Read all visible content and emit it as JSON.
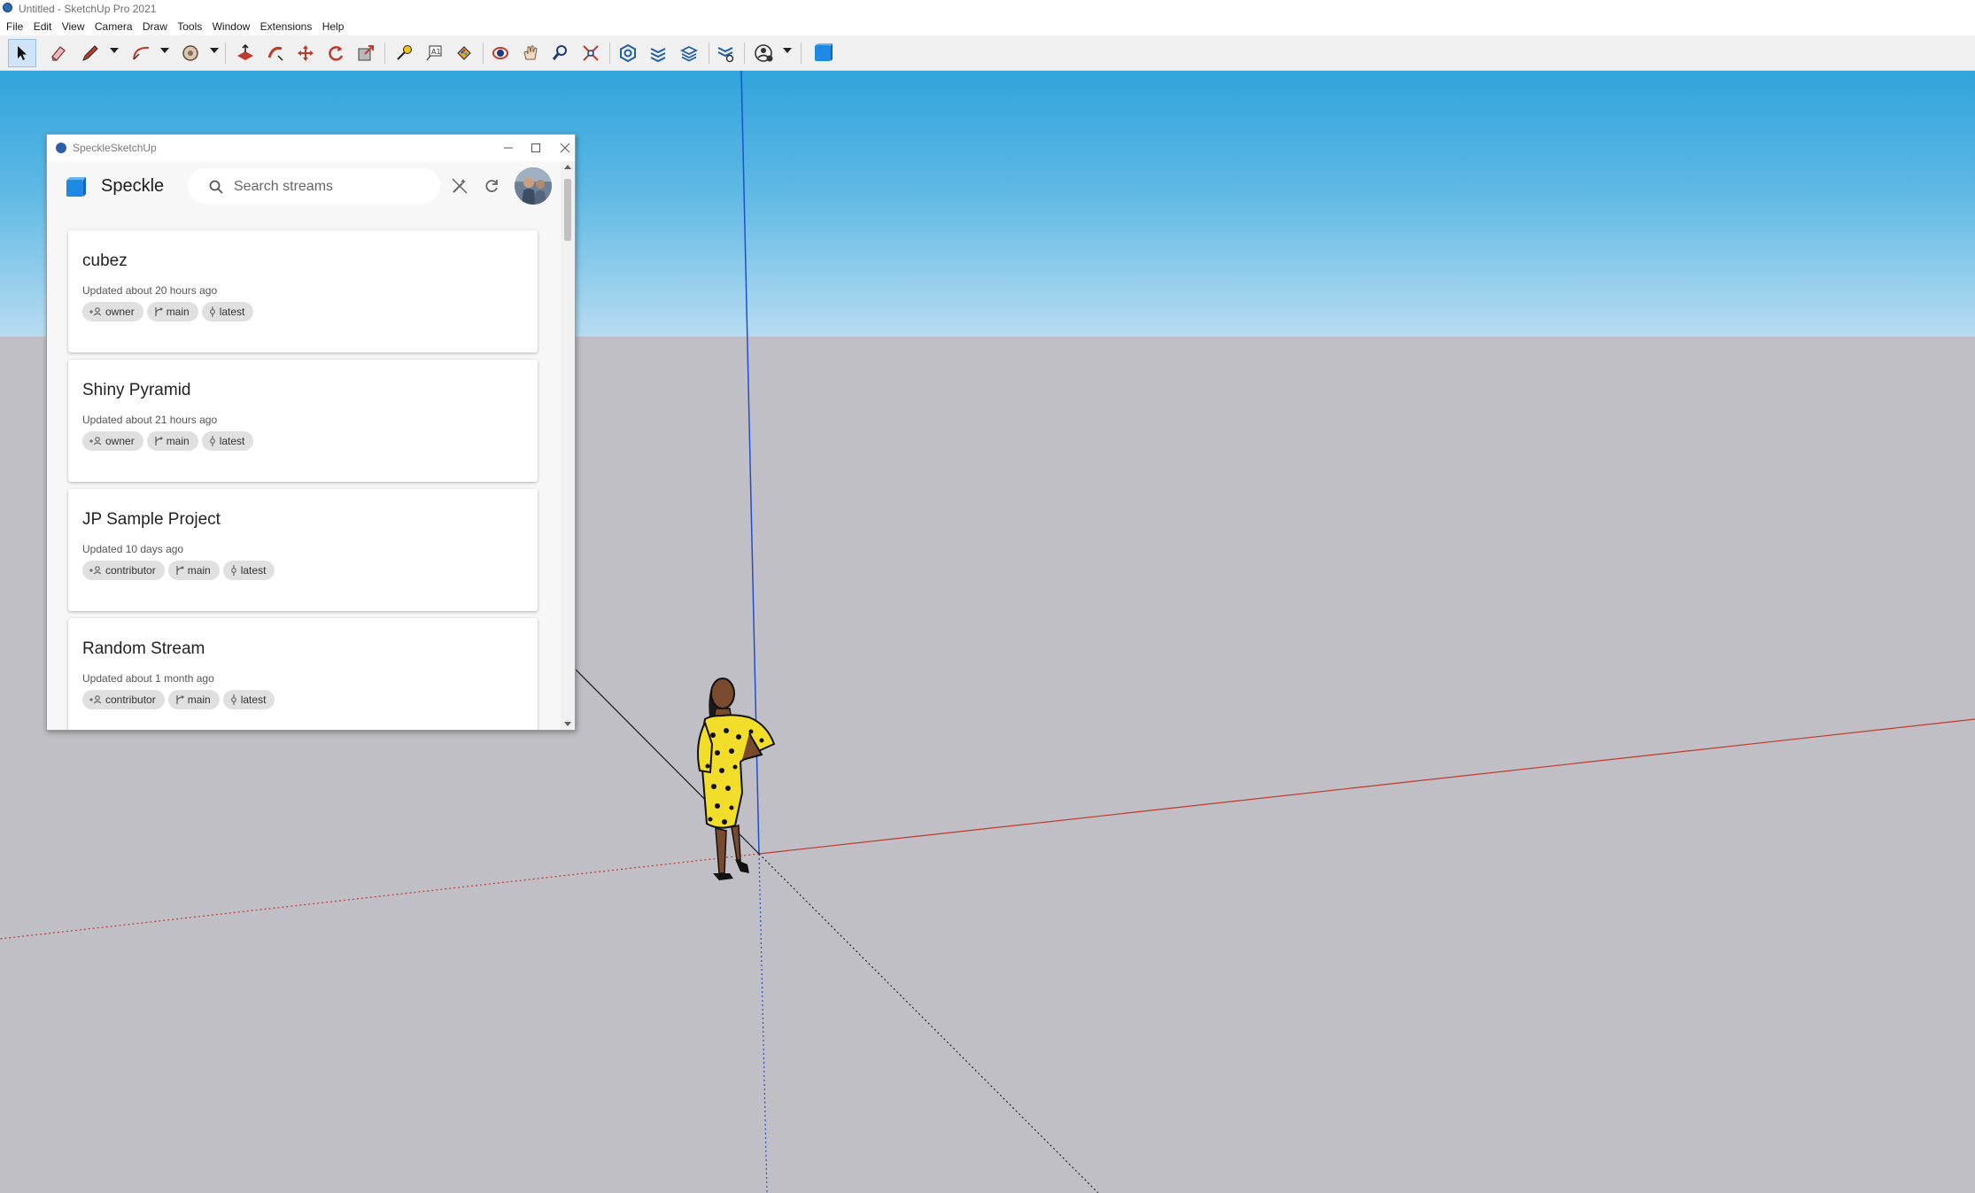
{
  "app": {
    "title": "Untitled - SketchUp Pro 2021",
    "menu": [
      "File",
      "Edit",
      "View",
      "Camera",
      "Draw",
      "Tools",
      "Window",
      "Extensions",
      "Help"
    ]
  },
  "toolbar": {
    "tools": [
      "select-tool",
      "eraser-tool",
      "line-tool",
      "arc-tool",
      "shapes-tool",
      "push-pull-tool",
      "offset-tool",
      "move-tool",
      "rotate-tool",
      "scale-tool",
      "tape-measure-tool",
      "text-tool",
      "paint-bucket-tool",
      "orbit-tool",
      "pan-tool",
      "zoom-tool",
      "zoom-extents-tool",
      "warehouse-tool",
      "extension-warehouse-tool",
      "layout-tool",
      "extension-manager-tool",
      "user-account-tool",
      "speckle-tool"
    ],
    "active_tool": "select-tool"
  },
  "speckle": {
    "window_title": "SpeckleSketchUp",
    "brand": "Speckle",
    "search_placeholder": "Search streams",
    "streams": [
      {
        "name": "cubez",
        "updated": "Updated about 20 hours ago",
        "role": "owner",
        "branch": "main",
        "commit": "latest"
      },
      {
        "name": "Shiny Pyramid",
        "updated": "Updated about 21 hours ago",
        "role": "owner",
        "branch": "main",
        "commit": "latest"
      },
      {
        "name": "JP Sample Project",
        "updated": "Updated 10 days ago",
        "role": "contributor",
        "branch": "main",
        "commit": "latest"
      },
      {
        "name": "Random Stream",
        "updated": "Updated about 1 month ago",
        "role": "contributor",
        "branch": "main",
        "commit": "latest"
      }
    ]
  },
  "colors": {
    "sky_top": "#30a4dc",
    "sky_horizon": "#b7dcf1",
    "ground": "#c0bfc5",
    "axis_red": "#c0392b",
    "axis_blue": "#1f4fd1",
    "speckle_blue": "#1e88e5"
  }
}
